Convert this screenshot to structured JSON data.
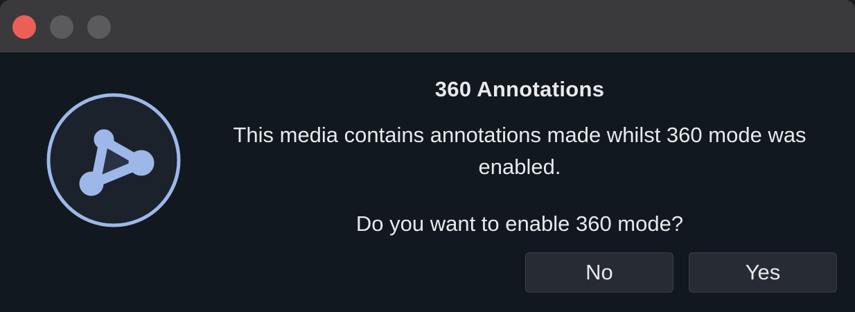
{
  "dialog": {
    "title": "360 Annotations",
    "message": "This media contains annotations made whilst 360 mode was enabled.",
    "question": "Do you want to enable 360 mode?",
    "buttons": {
      "no_label": "No",
      "yes_label": "Yes"
    }
  },
  "icons": {
    "app_icon": "annotation-network-icon",
    "close": "close-traffic-light",
    "minimize": "minimize-traffic-light",
    "maximize": "maximize-traffic-light"
  },
  "colors": {
    "background": "#111820",
    "titlebar": "#3a3a3c",
    "close_button": "#ec5f57",
    "inactive_light": "#5b5b5e",
    "icon_accent": "#9db8e8",
    "text": "#e8e9eb",
    "button_bg": "#272c34"
  }
}
